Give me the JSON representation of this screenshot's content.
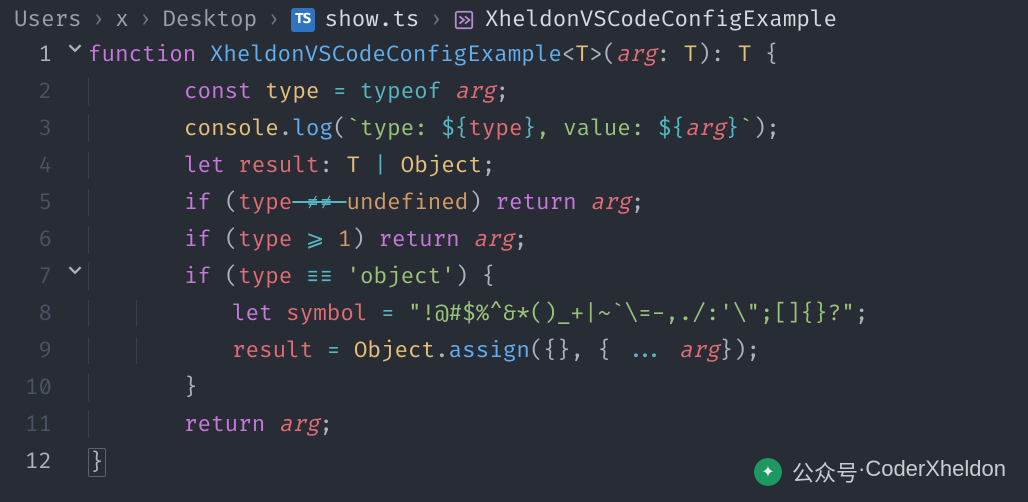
{
  "breadcrumb": {
    "items": [
      "Users",
      "x",
      "Desktop"
    ],
    "file_label": "show.ts",
    "file_badge_text": "TS",
    "symbol": "XheldonVSCodeConfigExample"
  },
  "gutter": {
    "lines": [
      "1",
      "2",
      "3",
      "4",
      "5",
      "6",
      "7",
      "8",
      "9",
      "10",
      "11",
      "12"
    ]
  },
  "code": {
    "l1": {
      "kw_function": "function",
      "fn": "XheldonVSCodeConfigExample",
      "lt": "<",
      "tparam": "T",
      "gt": ">",
      "lp": "(",
      "param": "arg",
      "colon1": ": ",
      "ptype": "T",
      "rp": ")",
      "colon2": ": ",
      "rtype": "T",
      "sp": " ",
      "lbrace": "{"
    },
    "l2": {
      "kw_const": "const",
      "name": "type",
      "eq": " = ",
      "kw_typeof": "typeof",
      "sp": " ",
      "arg": "arg",
      "semi": ";"
    },
    "l3": {
      "obj": "console",
      "dot": ".",
      "fn": "log",
      "lp": "(",
      "bt1": "`",
      "s1": "type: ",
      "dl1": "${",
      "v1": "type",
      "dr1": "}",
      "s2": ", value: ",
      "dl2": "${",
      "v2": "arg",
      "dr2": "}",
      "bt2": "`",
      "rp": ")",
      "semi": ";"
    },
    "l4": {
      "kw_let": "let",
      "name": "result",
      "colon": ": ",
      "t1": "T",
      "pipe": " | ",
      "t2": "Object",
      "semi": ";"
    },
    "l5": {
      "kw_if": "if",
      "lp": " (",
      "var": "type",
      "neq": " ≠≠ ",
      "undef": "undefined",
      "rp": ") ",
      "kw_ret": "return",
      "sp": " ",
      "arg": "arg",
      "semi": ";"
    },
    "l6": {
      "kw_if": "if",
      "lp": " (",
      "var": "type",
      "gte": " ⩾ ",
      "num": "1",
      "rp": ") ",
      "kw_ret": "return",
      "sp": " ",
      "arg": "arg",
      "semi": ";"
    },
    "l7": {
      "kw_if": "if",
      "lp": " (",
      "var": "type",
      "teq": " ≡≡ ",
      "str": "'object'",
      "rp": ") ",
      "lbrace": "{"
    },
    "l8": {
      "kw_let": "let",
      "name": "symbol",
      "eq": " = ",
      "str": "\"!@#$%^&*()_+|~`\\=-,./:'\\\";[]{}?\"",
      "semi": ";"
    },
    "l9": {
      "lhs": "result",
      "eq": " = ",
      "obj": "Object",
      "dot": ".",
      "fn": "assign",
      "lp": "(",
      "empty": "{}",
      "comma": ", ",
      "lb": "{ ",
      "spread": "... ",
      "arg": "arg",
      "rb": "}",
      "rp": ")",
      "semi": ";"
    },
    "l10": {
      "rbrace": "}"
    },
    "l11": {
      "kw_ret": "return",
      "sp": " ",
      "arg": "arg",
      "semi": ";"
    },
    "l12": {
      "rbrace": "}"
    }
  },
  "watermark": {
    "label_prefix": "公众号",
    "dot": " · ",
    "name": "CoderXheldon"
  }
}
